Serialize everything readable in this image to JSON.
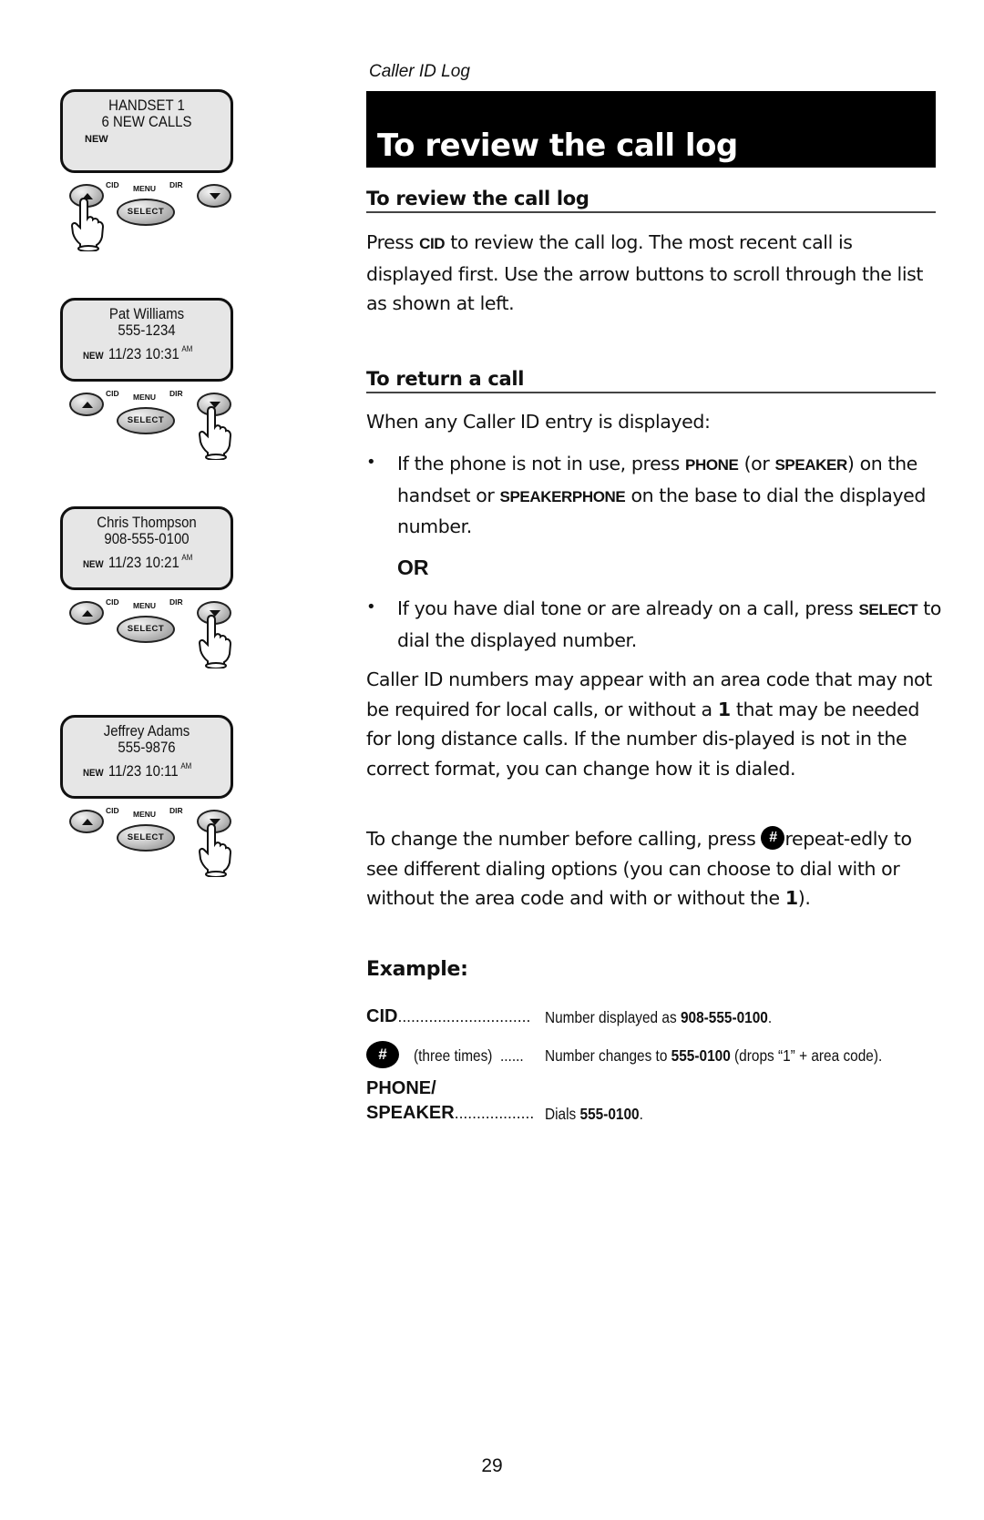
{
  "header": {
    "section_label": "Caller ID Log",
    "title": "To review the call log"
  },
  "handsets": [
    {
      "line1": "HANDSET 1",
      "line2": "6 NEW CALLS",
      "new_flag": "NEW",
      "date_time": "",
      "ampm": "",
      "pressed": "up"
    },
    {
      "line1": "Pat Williams",
      "line2": "555-1234",
      "new_flag": "NEW",
      "date_time": "11/23 10:31",
      "ampm": "AM",
      "pressed": "down"
    },
    {
      "line1": "Chris Thompson",
      "line2": "908-555-0100",
      "new_flag": "NEW",
      "date_time": "11/23 10:21",
      "ampm": "AM",
      "pressed": "down"
    },
    {
      "line1": "Jeffrey Adams",
      "line2": "555-9876",
      "new_flag": "NEW",
      "date_time": "11/23 10:11",
      "ampm": "AM",
      "pressed": "down"
    }
  ],
  "handset_buttons": {
    "cid": "CID",
    "menu": "MENU",
    "dir": "DIR",
    "select": "SELECT"
  },
  "review": {
    "heading": "To review the call log",
    "p1_before": "Press ",
    "p1_key": "CID",
    "p1_after": " to review the call log. The most recent call is displayed first. Use the arrow buttons to scroll through the list as shown at left."
  },
  "return_call": {
    "heading": "To return a call",
    "intro": "When any Caller ID entry is displayed:",
    "bullet1": {
      "t1": " If the phone is not in use, press ",
      "k1": "PHONE",
      "t2": " (or ",
      "k2": "SPEAKER",
      "t3": ") on the handset or ",
      "k3": "SPEAKERPHONE",
      "t4": " on the base to dial the displayed number."
    },
    "or_label": "OR",
    "bullet2": {
      "t1": "If you have dial tone or are already on a call, press ",
      "k1": "SELECT",
      "t2": " to dial the displayed number."
    },
    "para_area": {
      "t1": "Caller ID numbers may appear with an area code that may not be required for local calls, or without a ",
      "k1": "1",
      "t2": " that may be needed for long distance calls. If the number dis-played is not in the correct format, you can change how it is dialed."
    },
    "para_change": {
      "t1": "To change the number before calling, press ",
      "hash": "#",
      "t2": "repeat-edly to see different dialing options (you can choose to dial with or without the area code and with or without the ",
      "k1": "1",
      "t3": ")."
    }
  },
  "example": {
    "heading": "Example:",
    "rows": [
      {
        "key": "CID",
        "dots": "..............................",
        "desc_before": "Number displayed as ",
        "desc_bold": "908-555-0100",
        "desc_after": "."
      },
      {
        "key_icon": "#",
        "key_note": "(three times)",
        "dots": "......",
        "desc_before": "Number changes to ",
        "desc_bold": "555-0100",
        "desc_after": " (drops “1” + area code)."
      },
      {
        "key_line1": "PHONE/",
        "key": "SPEAKER",
        "dots": "..................",
        "desc_before": "Dials ",
        "desc_bold": "555-0100",
        "desc_after": "."
      }
    ]
  },
  "footer": {
    "page_number": "29"
  }
}
